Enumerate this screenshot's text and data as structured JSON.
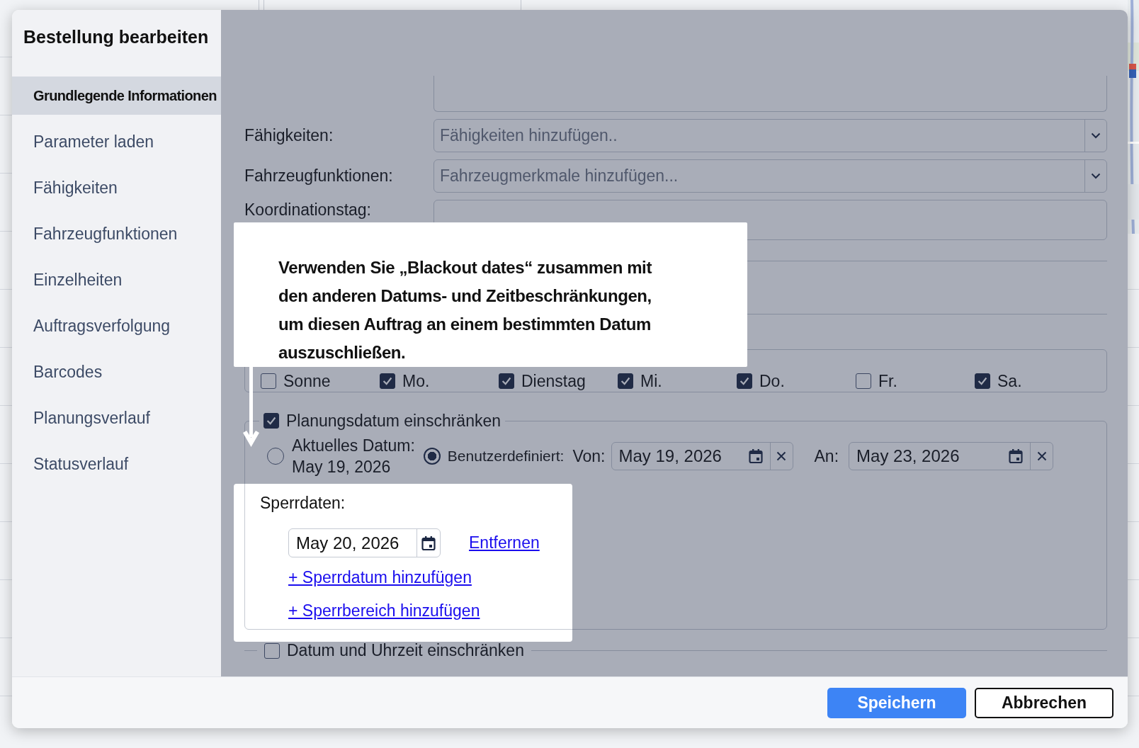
{
  "dialog": {
    "title": "Bestellung bearbeiten"
  },
  "sidebar": {
    "items": [
      {
        "label": "Grundlegende Informationen",
        "selected": true
      },
      {
        "label": "Parameter laden",
        "selected": false
      },
      {
        "label": "Fähigkeiten",
        "selected": false
      },
      {
        "label": "Fahrzeugfunktionen",
        "selected": false
      },
      {
        "label": "Einzelheiten",
        "selected": false
      },
      {
        "label": "Auftragsverfolgung",
        "selected": false
      },
      {
        "label": "Barcodes",
        "selected": false
      },
      {
        "label": "Planungsverlauf",
        "selected": false
      },
      {
        "label": "Statusverlauf",
        "selected": false
      }
    ]
  },
  "fields": [
    {
      "label": "Fähigkeiten:",
      "kind": "select",
      "placeholder": "Fähigkeiten hinzufügen.."
    },
    {
      "label": "Fahrzeugfunktionen:",
      "kind": "select",
      "placeholder": "Fahrzeugmerkmale hinzufügen..."
    },
    {
      "label": "Koordinationstag:",
      "kind": "text"
    }
  ],
  "weekdays": [
    {
      "label": "Sonne",
      "checked": false
    },
    {
      "label": "Mo.",
      "checked": true
    },
    {
      "label": "Dienstag",
      "checked": true
    },
    {
      "label": "Mi.",
      "checked": true
    },
    {
      "label": "Do.",
      "checked": true
    },
    {
      "label": "Fr.",
      "checked": false
    },
    {
      "label": "Sa.",
      "checked": true
    }
  ],
  "planning_date": {
    "label": "Planungsdatum einschränken",
    "checked": true,
    "current": {
      "label": "Aktuelles Datum:",
      "value": "May 19, 2026",
      "selected": false
    },
    "custom": {
      "label": "Benutzerdefiniert:",
      "selected": true
    },
    "from": {
      "label": "Von:",
      "value": "May 19, 2026"
    },
    "to": {
      "label": "An:",
      "value": "May 23, 2026"
    }
  },
  "blackout": {
    "label": "Sperrdaten:",
    "dates": [
      {
        "value": "May 20, 2026",
        "remove": "Entfernen"
      }
    ],
    "links": [
      "+ Sperrdatum hinzufügen",
      "+ Sperrbereich hinzufügen"
    ]
  },
  "datetime_restriction": {
    "label": "Datum und Uhrzeit einschränken",
    "checked": false
  },
  "buttons": [
    {
      "label": "Speichern",
      "kind": "primary"
    },
    {
      "label": "Abbrechen",
      "kind": "secondary"
    }
  ],
  "callout": {
    "text": "Verwenden Sie „Blackout dates“ zusammen mit den anderen Datums- und Zeitbeschränkungen, um diesen Auftrag an einem bestimmten Datum auszuschließen."
  }
}
